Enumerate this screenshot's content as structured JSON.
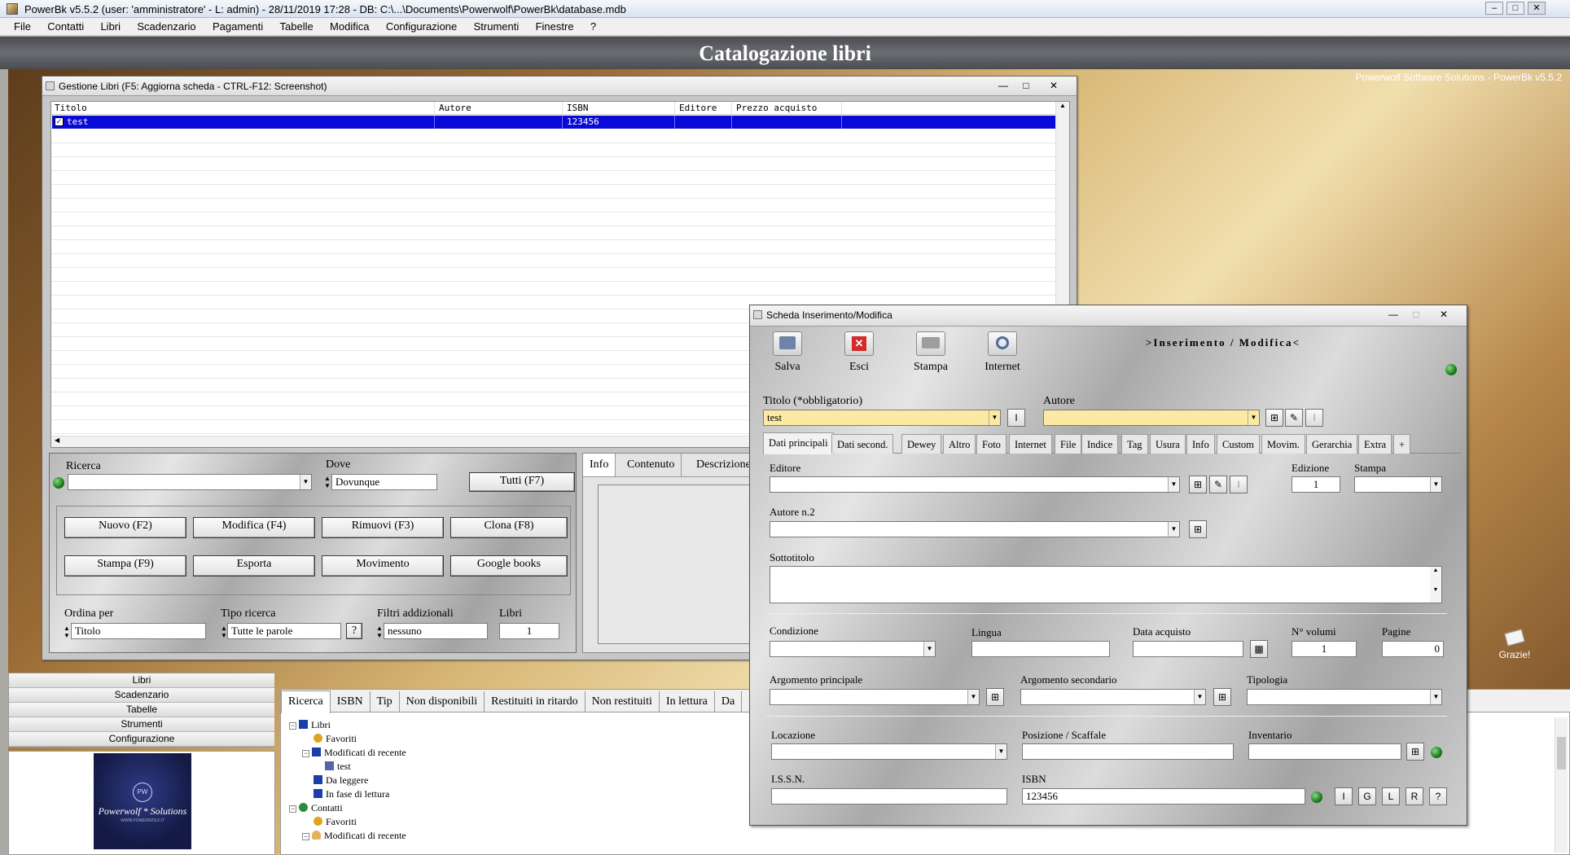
{
  "app": {
    "title": "PowerBk v5.5.2  (user: 'amministratore'  - L: admin) - 28/11/2019 17:28 - DB: C:\\...\\Documents\\Powerwolf\\PowerBk\\database.mdb",
    "menu": [
      "File",
      "Contatti",
      "Libri",
      "Scadenzario",
      "Pagamenti",
      "Tabelle",
      "Modifica",
      "Configurazione",
      "Strumenti",
      "Finestre",
      "?"
    ],
    "header": "Catalogazione libri",
    "brand": "Powerwolf Software Solutions - PowerBk v5.5.2",
    "thanks": "Grazie!",
    "logo_name": "Powerwolf * Solutions",
    "logo_mark": "PW",
    "logo_url": "WWW.POWERWOLF.IT"
  },
  "sidebar": {
    "items": [
      "Libri",
      "Scadenzario",
      "Tabelle",
      "Strumenti",
      "Configurazione"
    ]
  },
  "bottom": {
    "tabs": [
      "Ricerca",
      "ISBN",
      "Tip",
      "Non disponibili",
      "Restituiti in ritardo",
      "Non restituiti",
      "In lettura",
      "Da"
    ],
    "tree": [
      {
        "label": "Libri",
        "level": 0,
        "expander": "⊟",
        "icon": "books-icon"
      },
      {
        "label": "Favoriti",
        "level": 1,
        "expander": "",
        "icon": "ribbon-icon"
      },
      {
        "label": "Modificati di recente",
        "level": 1,
        "expander": "⊟",
        "icon": "books-icon"
      },
      {
        "label": "test",
        "level": 2,
        "expander": "",
        "icon": "book-icon"
      },
      {
        "label": "Da leggere",
        "level": 1,
        "expander": "",
        "icon": "books-icon"
      },
      {
        "label": "In fase di lettura",
        "level": 1,
        "expander": "",
        "icon": "books-icon"
      },
      {
        "label": "Contatti",
        "level": 0,
        "expander": "⊟",
        "icon": "globe-icon"
      },
      {
        "label": "Favoriti",
        "level": 1,
        "expander": "",
        "icon": "ribbon-icon"
      },
      {
        "label": "Modificati di recente",
        "level": 1,
        "expander": "⊟",
        "icon": "person-icon"
      }
    ]
  },
  "gestione": {
    "title": "Gestione Libri (F5: Aggiorna scheda - CTRL-F12: Screenshot)",
    "columns": [
      "Titolo",
      "Autore",
      "ISBN",
      "Editore",
      "Prezzo acquisto"
    ],
    "rows": [
      {
        "titolo": "test",
        "autore": "",
        "isbn": "123456",
        "editore": "",
        "prezzo": ""
      }
    ],
    "search": {
      "ricerca_label": "Ricerca",
      "ricerca_value": "",
      "dove_label": "Dove",
      "dove_value": "Dovunque",
      "tutti_btn": "Tutti (F7)"
    },
    "buttons": [
      "Nuovo (F2)",
      "Modifica (F4)",
      "Rimuovi (F3)",
      "Clona (F8)",
      "Stampa (F9)",
      "Esporta",
      "Movimento",
      "Google books"
    ],
    "sort": {
      "ordina_label": "Ordina per",
      "ordina_value": "Titolo",
      "tipo_label": "Tipo ricerca",
      "tipo_value": "Tutte le parole",
      "help": "?",
      "filtri_label": "Filtri addizionali",
      "filtri_value": "nessuno",
      "libri_label": "Libri",
      "libri_value": "1"
    },
    "info_tabs": [
      "Info",
      "Contenuto",
      "Descrizione"
    ]
  },
  "scheda": {
    "title": "Scheda Inserimento/Modifica",
    "mode": ">Inserimento / Modifica<",
    "toolbar": [
      "Salva",
      "Esci",
      "Stampa",
      "Internet"
    ],
    "titolo_label": "Titolo (*obbligatorio)",
    "titolo_value": "test",
    "autore_label": "Autore",
    "autore_value": "",
    "tabs": [
      "Dati principali",
      "Dati second.",
      "Dewey",
      "Altro",
      "Foto",
      "Internet",
      "File",
      "Indice",
      "Tag",
      "Usura",
      "Info",
      "Custom",
      "Movim.",
      "Gerarchia",
      "Extra",
      "+"
    ],
    "fields": {
      "editore": "Editore",
      "edizione": "Edizione",
      "edizione_value": "1",
      "stampa": "Stampa",
      "autore2": "Autore n.2",
      "sottotitolo": "Sottotitolo",
      "condizione": "Condizione",
      "lingua": "Lingua",
      "data_acquisto": "Data acquisto",
      "n_volumi": "N° volumi",
      "n_volumi_value": "1",
      "pagine": "Pagine",
      "pagine_value": "0",
      "arg_principale": "Argomento principale",
      "arg_secondario": "Argomento secondario",
      "tipologia": "Tipologia",
      "locazione": "Locazione",
      "posizione": "Posizione / Scaffale",
      "inventario": "Inventario",
      "issn": "I.S.S.N.",
      "isbn": "ISBN",
      "isbn_value": "123456"
    },
    "isbn_buttons": [
      "I",
      "G",
      "L",
      "R",
      "?"
    ],
    "btn_I": "I"
  },
  "colors": {
    "selection": "#0a0ad6",
    "required": "#fce9a3",
    "led": "#2a9a2a",
    "header_text": "#ffffff"
  }
}
